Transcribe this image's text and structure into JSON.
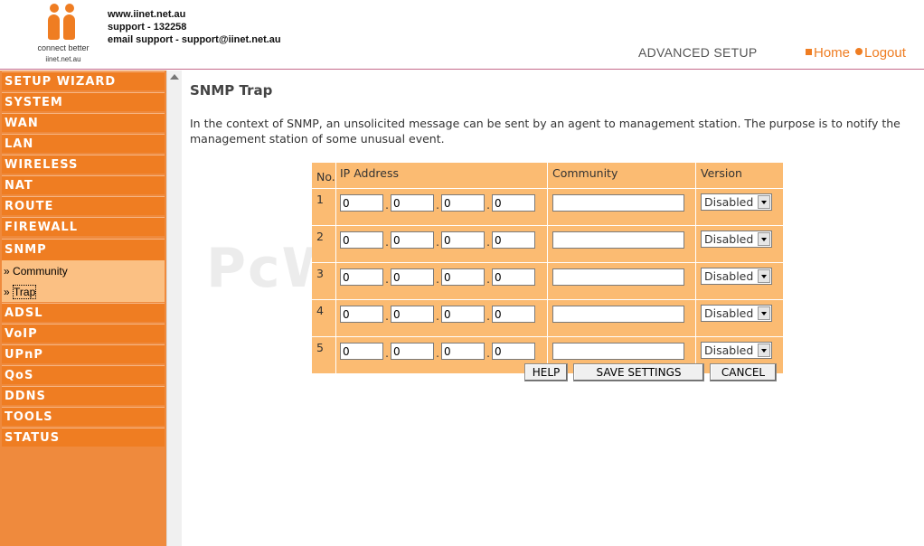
{
  "header": {
    "logo_tagline": "connect better",
    "logo_url": "iinet.net.au",
    "contact_lines": [
      "www.iinet.net.au",
      "support - 132258",
      "email support - support@iinet.net.au"
    ],
    "section_title": "ADVANCED SETUP",
    "links": {
      "home": "Home",
      "logout": "Logout"
    }
  },
  "sidebar": {
    "items": [
      "SETUP WIZARD",
      "SYSTEM",
      "WAN",
      "LAN",
      "WIRELESS",
      "NAT",
      "ROUTE",
      "FIREWALL",
      "SNMP",
      "ADSL",
      "VoIP",
      "UPnP",
      "QoS",
      "DDNS",
      "TOOLS",
      "STATUS"
    ],
    "submenu": [
      {
        "prefix": "»",
        "label": "Community"
      },
      {
        "prefix": "»",
        "label": "Trap",
        "active": true
      }
    ]
  },
  "main": {
    "title": "SNMP Trap",
    "description": "In the context of SNMP, an unsolicited message can be sent by an agent to management station. The purpose is to notify the management station of some unusual event.",
    "table": {
      "headers": [
        "No.",
        "IP Address",
        "Community",
        "Version"
      ],
      "rows": [
        {
          "no": "1",
          "ip": [
            "0",
            "0",
            "0",
            "0"
          ],
          "community": "",
          "version": "Disabled"
        },
        {
          "no": "2",
          "ip": [
            "0",
            "0",
            "0",
            "0"
          ],
          "community": "",
          "version": "Disabled"
        },
        {
          "no": "3",
          "ip": [
            "0",
            "0",
            "0",
            "0"
          ],
          "community": "",
          "version": "Disabled"
        },
        {
          "no": "4",
          "ip": [
            "0",
            "0",
            "0",
            "0"
          ],
          "community": "",
          "version": "Disabled"
        },
        {
          "no": "5",
          "ip": [
            "0",
            "0",
            "0",
            "0"
          ],
          "community": "",
          "version": "Disabled"
        }
      ]
    },
    "buttons": {
      "help": "HELP",
      "save": "SAVE SETTINGS",
      "cancel": "CANCEL"
    }
  },
  "watermark": "PcWinTech.com",
  "colors": {
    "accent": "#ef7d22",
    "table_bg": "#fbbb72",
    "submenu_bg": "#fbc083"
  }
}
